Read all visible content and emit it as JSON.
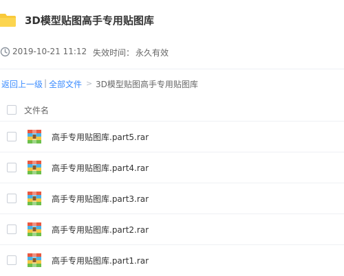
{
  "header": {
    "title": "3D模型贴图高手专用贴图库",
    "folder_icon": "folder-icon",
    "folder_color": "#f9c93a"
  },
  "meta": {
    "date": "2019-10-21 11:12",
    "expire_label": "失效时间：",
    "expire_value": "永久有效",
    "clock_icon": "clock-icon"
  },
  "breadcrumb": {
    "back": "返回上一级",
    "separator": "|",
    "all_files": "全部文件",
    "arrow": ">",
    "current": "3D模型贴图高手专用贴图库",
    "link_color": "#3b8cff"
  },
  "file_list": {
    "column_title": "文件名",
    "files": [
      {
        "name": "高手专用贴图库.part5.rar",
        "icon": "rar-archive-icon"
      },
      {
        "name": "高手专用贴图库.part4.rar",
        "icon": "rar-archive-icon"
      },
      {
        "name": "高手专用贴图库.part3.rar",
        "icon": "rar-archive-icon"
      },
      {
        "name": "高手专用贴图库.part2.rar",
        "icon": "rar-archive-icon"
      },
      {
        "name": "高手专用贴图库.part1.rar",
        "icon": "rar-archive-icon"
      }
    ]
  }
}
